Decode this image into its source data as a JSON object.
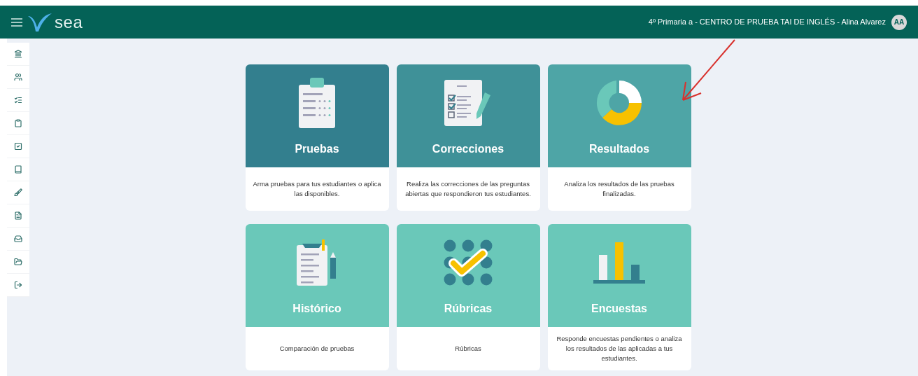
{
  "header": {
    "logo_text": "sea",
    "context": "4º Primaria a - CENTRO DE PRUEBA TAI DE INGLÉS - Alina Alvarez",
    "avatar": "AA"
  },
  "sidebar": {
    "items": [
      {
        "kind": "building"
      },
      {
        "kind": "users"
      },
      {
        "kind": "list"
      },
      {
        "kind": "clipboard"
      },
      {
        "kind": "checkbox"
      },
      {
        "kind": "book"
      },
      {
        "kind": "brush"
      },
      {
        "kind": "file"
      },
      {
        "kind": "inbox"
      },
      {
        "kind": "folder"
      },
      {
        "kind": "logout"
      }
    ]
  },
  "cards": [
    {
      "kind": "tests",
      "title": "Pruebas",
      "description": "Arma pruebas para tus estudiantes o aplica las disponibles.",
      "color": "#337f8e"
    },
    {
      "kind": "corrections",
      "title": "Correcciones",
      "description": "Realiza las correcciones de las preguntas abiertas que respondieron tus estudiantes.",
      "color": "#3f9198"
    },
    {
      "kind": "results",
      "title": "Resultados",
      "description": "Analiza los resultados de las pruebas finalizadas.",
      "color": "#4ea5a6"
    },
    {
      "kind": "history",
      "title": "Histórico",
      "description": "Comparación de pruebas",
      "color": "#6ac8b9"
    },
    {
      "kind": "rubrics",
      "title": "Rúbricas",
      "description": "Rúbricas",
      "color": "#6ac8b9"
    },
    {
      "kind": "surveys",
      "title": "Encuestas",
      "description": "Responde encuestas pendientes o analiza los resultados de las aplicadas a tus estudiantes.",
      "color": "#6ac8b9"
    }
  ]
}
